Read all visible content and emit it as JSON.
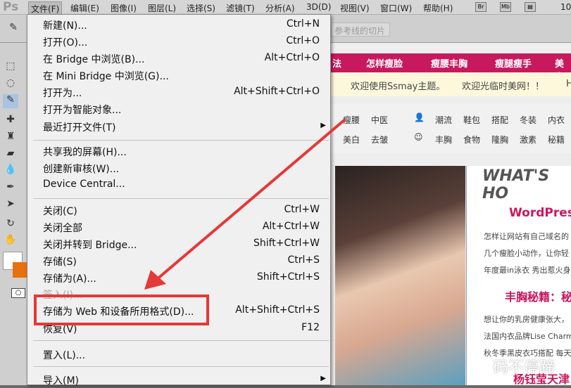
{
  "app": {
    "logo": "Ps",
    "menus": [
      "文件(F)",
      "编辑(E)",
      "图像(I)",
      "图层(L)",
      "选择(S)",
      "滤镜(T)",
      "分析(A)",
      "3D(D)",
      "视图(V)",
      "窗口(W)",
      "帮助(H)"
    ],
    "bridge_btn": "Br",
    "minibridge_btn": "Mb",
    "zoom": "10"
  },
  "options": {
    "slice_field": "参考线的切片"
  },
  "file_menu": {
    "items": [
      {
        "label": "新建(N)...",
        "shortcut": "Ctrl+N"
      },
      {
        "label": "打开(O)...",
        "shortcut": "Ctrl+O"
      },
      {
        "label": "在 Bridge 中浏览(B)...",
        "shortcut": "Alt+Ctrl+O"
      },
      {
        "label": "在 Mini Bridge 中浏览(G)...",
        "shortcut": ""
      },
      {
        "label": "打开为...",
        "shortcut": "Alt+Shift+Ctrl+O"
      },
      {
        "label": "打开为智能对象...",
        "shortcut": ""
      },
      {
        "label": "最近打开文件(T)",
        "shortcut": ""
      },
      {
        "label": "共享我的屏幕(H)...",
        "shortcut": ""
      },
      {
        "label": "创建新审核(W)...",
        "shortcut": ""
      },
      {
        "label": "Device Central...",
        "shortcut": ""
      },
      {
        "label": "关闭(C)",
        "shortcut": "Ctrl+W"
      },
      {
        "label": "关闭全部",
        "shortcut": "Alt+Ctrl+W"
      },
      {
        "label": "关闭并转到 Bridge...",
        "shortcut": "Shift+Ctrl+W"
      },
      {
        "label": "存储(S)",
        "shortcut": "Ctrl+S"
      },
      {
        "label": "存储为(A)...",
        "shortcut": "Shift+Ctrl+S"
      },
      {
        "label": "签入(I)...",
        "shortcut": ""
      },
      {
        "label": "存储为 Web 和设备所用格式(D)...",
        "shortcut": "Alt+Shift+Ctrl+S"
      },
      {
        "label": "恢复(V)",
        "shortcut": "F12"
      },
      {
        "label": "置入(L)...",
        "shortcut": ""
      },
      {
        "label": "导入(M)",
        "shortcut": ""
      }
    ]
  },
  "webpage": {
    "nav": [
      "法",
      "怎样瘦脸",
      "瘦腰丰胸",
      "瘦腿瘦手",
      "美容"
    ],
    "welcome": [
      "欢迎使用Ssmay主题。",
      "欢迎光临时美网！！",
      "H"
    ],
    "cats_row1": [
      "瘦腰",
      "中医",
      "潮流",
      "鞋包",
      "搭配",
      "冬装",
      "内衣"
    ],
    "cats_row2": [
      "美白",
      "去皱",
      "丰胸",
      "食物",
      "隆胸",
      "激素",
      "秘籍"
    ],
    "heading": "WHAT'S HO",
    "titles": [
      "WordPress",
      "丰胸秘籍：秘",
      "杨钰莹天津"
    ],
    "paras": [
      "怎样让网站有自己域名的",
      "几个瘦脸小动作，让你轻",
      "年度最in泳衣 秀出惹火身",
      "想让你的乳房健康张大，",
      "法国内衣品牌Lise Charm",
      "秋冬季黑皮衣巧搭配 每天"
    ]
  },
  "watermark": "码不停蹄",
  "colors": {
    "highlight": "#e53838",
    "brand": "#c8185e"
  }
}
